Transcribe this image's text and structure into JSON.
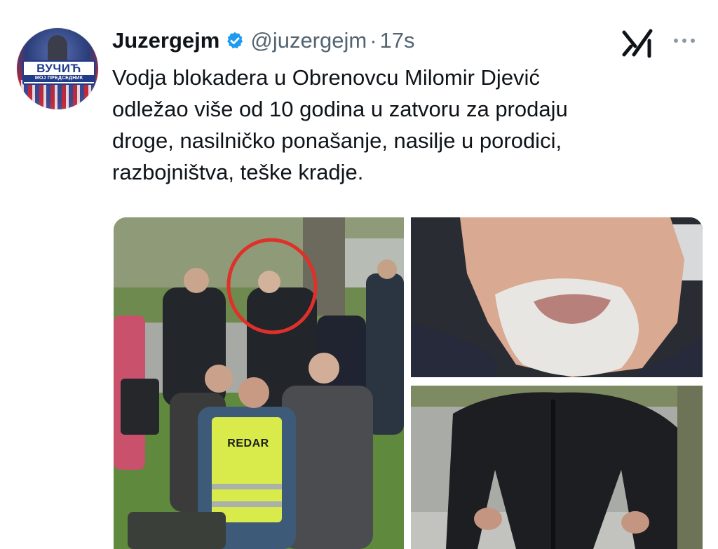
{
  "tweet": {
    "author": {
      "display_name": "Juzergejm",
      "handle": "@juzergejm",
      "verified": true,
      "avatar": {
        "brand_main": "ВУЧИЋ",
        "brand_sub": "МОЈ ПРЕДСЕДНИК"
      }
    },
    "separator": "·",
    "timestamp": "17s",
    "text": "Vodja blokadera u Obrenovcu Milomir Djević\nodležao više od 10 godina u zatvoru za prodaju\ndroge, nasilničko ponašanje, nasilje u porodici,\nrazbojništva, teške kradje.",
    "media": {
      "count": 3,
      "left_photo_vest_text": "REDAR"
    }
  },
  "icons": {
    "verified": "verified-badge-icon",
    "grok": "grok-icon",
    "more": "more-options-icon"
  },
  "colors": {
    "verified_badge": "#1d9bf0",
    "secondary_text": "#536471",
    "annotation_circle": "#e0302a",
    "brand_blue": "#1f3b8a"
  }
}
